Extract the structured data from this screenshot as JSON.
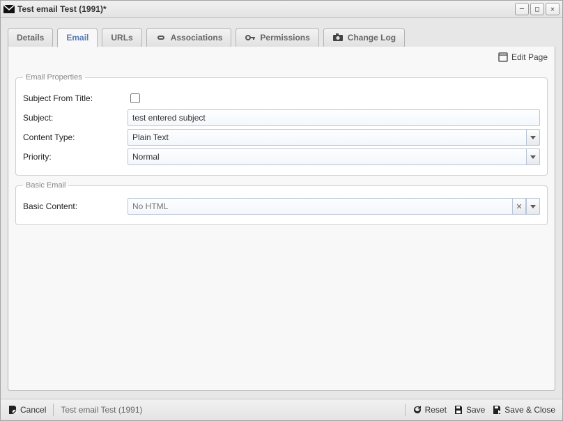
{
  "window": {
    "title": "Test email Test (1991)*"
  },
  "tabs": {
    "details": "Details",
    "email": "Email",
    "urls": "URLs",
    "associations": "Associations",
    "permissions": "Permissions",
    "changelog": "Change Log"
  },
  "toolbar": {
    "edit_page": "Edit Page"
  },
  "email_properties": {
    "legend": "Email Properties",
    "subject_from_title_label": "Subject From Title:",
    "subject_label": "Subject:",
    "subject_value": "test entered subject",
    "content_type_label": "Content Type:",
    "content_type_value": "Plain Text",
    "priority_label": "Priority:",
    "priority_value": "Normal"
  },
  "basic_email": {
    "legend": "Basic Email",
    "basic_content_label": "Basic Content:",
    "basic_content_placeholder": "No HTML"
  },
  "footer": {
    "cancel": "Cancel",
    "breadcrumb": "Test email Test (1991)",
    "reset": "Reset",
    "save": "Save",
    "save_close": "Save & Close"
  }
}
